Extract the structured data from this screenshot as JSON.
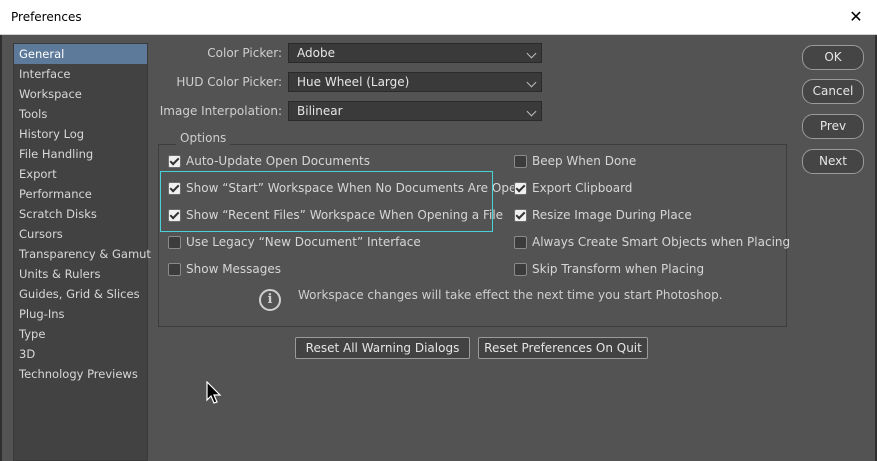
{
  "window": {
    "title": "Preferences",
    "close_glyph": "✕"
  },
  "sidebar": {
    "items": [
      {
        "label": "General"
      },
      {
        "label": "Interface"
      },
      {
        "label": "Workspace"
      },
      {
        "label": "Tools"
      },
      {
        "label": "History Log"
      },
      {
        "label": "File Handling"
      },
      {
        "label": "Export"
      },
      {
        "label": "Performance"
      },
      {
        "label": "Scratch Disks"
      },
      {
        "label": "Cursors"
      },
      {
        "label": "Transparency & Gamut"
      },
      {
        "label": "Units & Rulers"
      },
      {
        "label": "Guides, Grid & Slices"
      },
      {
        "label": "Plug-Ins"
      },
      {
        "label": "Type"
      },
      {
        "label": "3D"
      },
      {
        "label": "Technology Previews"
      }
    ],
    "selected_label": "General"
  },
  "settings": {
    "color_picker": {
      "label": "Color Picker:",
      "value": "Adobe"
    },
    "hud_color_picker": {
      "label": "HUD Color Picker:",
      "value": "Hue Wheel (Large)"
    },
    "image_interpolation": {
      "label": "Image Interpolation:",
      "value": "Bilinear"
    }
  },
  "options": {
    "title": "Options",
    "left": [
      {
        "label": "Auto-Update Open Documents",
        "checked": true
      },
      {
        "label": "Show “Start” Workspace When No Documents Are Open",
        "checked": true
      },
      {
        "label": "Show “Recent Files” Workspace When Opening a File",
        "checked": true
      },
      {
        "label": "Use Legacy “New Document” Interface",
        "checked": false
      },
      {
        "label": "Show Messages",
        "checked": false
      }
    ],
    "right": [
      {
        "label": "Beep When Done",
        "checked": false
      },
      {
        "label": "Export Clipboard",
        "checked": true
      },
      {
        "label": "Resize Image During Place",
        "checked": true
      },
      {
        "label": "Always Create Smart Objects when Placing",
        "checked": false
      },
      {
        "label": "Skip Transform when Placing",
        "checked": false
      }
    ],
    "info_glyph": "i",
    "info_text": "Workspace changes will take effect the next time you start Photoshop."
  },
  "actions": {
    "reset_warning": "Reset All Warning Dialogs",
    "reset_prefs": "Reset Preferences On Quit"
  },
  "side_buttons": {
    "ok": "OK",
    "cancel": "Cancel",
    "prev": "Prev",
    "next": "Next"
  },
  "colors": {
    "highlight": "#4ad1d8",
    "selected": "#5d7a9b",
    "background": "#535353"
  }
}
